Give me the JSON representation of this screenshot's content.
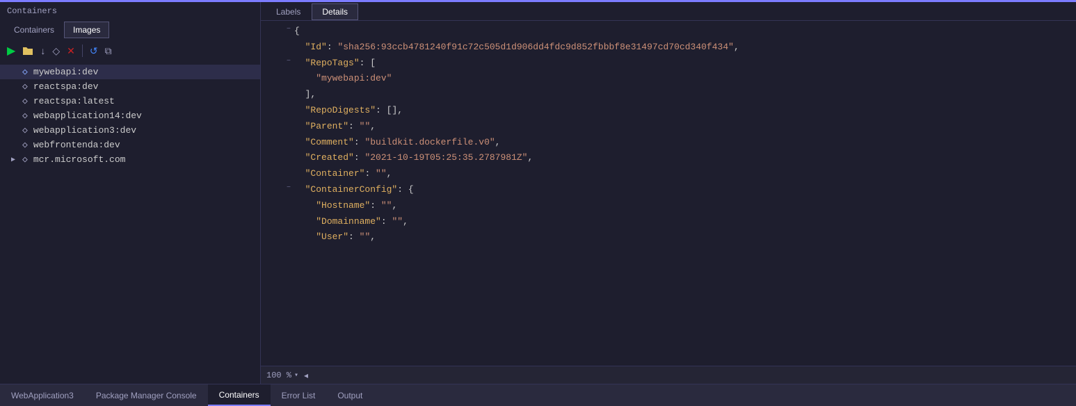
{
  "topbar": {
    "title": "Containers"
  },
  "leftPanel": {
    "title": "Containers",
    "tabs": [
      {
        "label": "Containers",
        "active": false
      },
      {
        "label": "Images",
        "active": true
      }
    ],
    "toolbar": {
      "run_label": "▶",
      "folder_label": "🗀",
      "pull_label": "↓",
      "tag_label": "◇",
      "delete_label": "✕",
      "refresh_label": "↺",
      "copy_label": "⧉"
    },
    "images": [
      {
        "name": "mywebapi:dev",
        "selected": true,
        "hasChildren": false
      },
      {
        "name": "reactspa:dev",
        "selected": false,
        "hasChildren": false
      },
      {
        "name": "reactspa:latest",
        "selected": false,
        "hasChildren": false
      },
      {
        "name": "webapplication14:dev",
        "selected": false,
        "hasChildren": false
      },
      {
        "name": "webapplication3:dev",
        "selected": false,
        "hasChildren": false
      },
      {
        "name": "webfrontenda:dev",
        "selected": false,
        "hasChildren": false
      },
      {
        "name": "mcr.microsoft.com",
        "selected": false,
        "hasChildren": true
      }
    ]
  },
  "rightPanel": {
    "tabs": [
      {
        "label": "Labels",
        "active": false
      },
      {
        "label": "Details",
        "active": true
      }
    ],
    "json_lines": [
      {
        "gutter": "",
        "collapse": true,
        "indent": 0,
        "content": "{",
        "type": "bracket"
      },
      {
        "gutter": "",
        "collapse": false,
        "indent": 2,
        "key": "\"Id\"",
        "separator": ": ",
        "value": "\"sha256:93ccb4781240f91c72c505d1d906dd4fdc9d852fbbbf8e31497cd70cd340f434\"",
        "trail": ",",
        "type": "keyval"
      },
      {
        "gutter": "",
        "collapse": true,
        "indent": 2,
        "key": "\"RepoTags\"",
        "separator": ": ",
        "value": "[",
        "trail": "",
        "type": "keyval_open"
      },
      {
        "gutter": "",
        "collapse": false,
        "indent": 4,
        "value": "\"mywebapi:dev\"",
        "trail": "",
        "type": "val"
      },
      {
        "gutter": "",
        "collapse": false,
        "indent": 2,
        "value": "],",
        "trail": "",
        "type": "plain"
      },
      {
        "gutter": "",
        "collapse": false,
        "indent": 2,
        "key": "\"RepoDigests\"",
        "separator": ": ",
        "value": "[]",
        "trail": ",",
        "type": "keyval"
      },
      {
        "gutter": "",
        "collapse": false,
        "indent": 2,
        "key": "\"Parent\"",
        "separator": ": ",
        "value": "\"\"",
        "trail": ",",
        "type": "keyval"
      },
      {
        "gutter": "",
        "collapse": false,
        "indent": 2,
        "key": "\"Comment\"",
        "separator": ": ",
        "value": "\"buildkit.dockerfile.v0\"",
        "trail": ",",
        "type": "keyval"
      },
      {
        "gutter": "",
        "collapse": false,
        "indent": 2,
        "key": "\"Created\"",
        "separator": ": ",
        "value": "\"2021-10-19T05:25:35.2787981Z\"",
        "trail": ",",
        "type": "keyval"
      },
      {
        "gutter": "",
        "collapse": false,
        "indent": 2,
        "key": "\"Container\"",
        "separator": ": ",
        "value": "\"\"",
        "trail": ",",
        "type": "keyval"
      },
      {
        "gutter": "",
        "collapse": true,
        "indent": 2,
        "key": "\"ContainerConfig\"",
        "separator": ": ",
        "value": "{",
        "trail": "",
        "type": "keyval_open"
      },
      {
        "gutter": "",
        "collapse": false,
        "indent": 4,
        "key": "\"Hostname\"",
        "separator": ": ",
        "value": "\"\"",
        "trail": ",",
        "type": "keyval"
      },
      {
        "gutter": "",
        "collapse": false,
        "indent": 4,
        "key": "\"Domainname\"",
        "separator": ": ",
        "value": "\"\"",
        "trail": ",",
        "type": "keyval"
      },
      {
        "gutter": "",
        "collapse": false,
        "indent": 4,
        "key": "\"User\"",
        "separator": ": ",
        "value": "\"\"",
        "trail": ",",
        "type": "keyval"
      }
    ],
    "statusbar": {
      "zoom": "100 %"
    }
  },
  "bottomTabs": [
    {
      "label": "WebApplication3",
      "active": false
    },
    {
      "label": "Package Manager Console",
      "active": false
    },
    {
      "label": "Containers",
      "active": true
    },
    {
      "label": "Error List",
      "active": false
    },
    {
      "label": "Output",
      "active": false
    }
  ],
  "colors": {
    "accent": "#7c7cff",
    "bg": "#1e1e2e",
    "key_color": "#e0b060",
    "string_color": "#ce9178"
  }
}
